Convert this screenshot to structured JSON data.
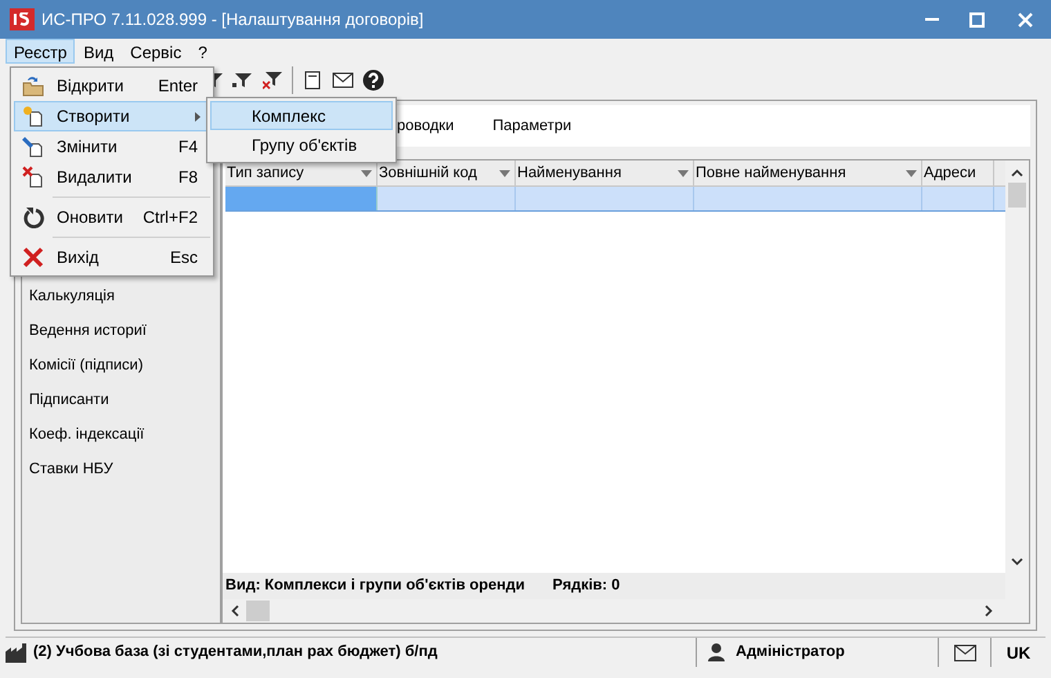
{
  "window": {
    "title": "ИС-ПРО 7.11.028.999 - [Налаштування договорів]"
  },
  "menubar": [
    {
      "label": "Реєстр",
      "selected": true
    },
    {
      "label": "Вид",
      "selected": false
    },
    {
      "label": "Сервіс",
      "selected": false
    },
    {
      "label": "?",
      "selected": false
    }
  ],
  "menu": {
    "groups": [
      [
        {
          "label": "Відкрити",
          "shortcut": "Enter",
          "submenu": false,
          "selected": false
        },
        {
          "label": "Створити",
          "submenu": true,
          "selected": true
        },
        {
          "label": "Змінити",
          "shortcut": "F4",
          "submenu": false,
          "selected": false
        },
        {
          "label": "Видалити",
          "shortcut": "F8",
          "submenu": false,
          "selected": false
        }
      ],
      [
        {
          "label": "Оновити",
          "shortcut": "Ctrl+F2",
          "submenu": false,
          "selected": false
        }
      ],
      [
        {
          "label": "Вихід",
          "shortcut": "Esc",
          "submenu": false,
          "selected": false
        }
      ]
    ]
  },
  "submenu": [
    {
      "label": "Комплекс",
      "selected": true
    },
    {
      "label": "Групу об'єктів",
      "selected": false
    }
  ],
  "tabs": [
    {
      "label": "роводки",
      "selected": false
    },
    {
      "label": "Параметри",
      "selected": false
    }
  ],
  "sidebar": {
    "items": [
      "Калькуляція",
      "Ведення историї",
      "Комісії (підписи)",
      "Підписанти",
      "Коеф. індексації",
      "Ставки НБУ"
    ]
  },
  "table": {
    "columns": [
      "Тип запису",
      "Зовнішній код",
      "Найменування",
      "Повне найменування",
      "Адреси"
    ],
    "rows": [
      {
        "selected": true
      }
    ],
    "footer_view": "Вид: Комплекси і групи об'єктів оренди",
    "footer_count": "Рядків: 0"
  },
  "status_bar": {
    "database": "(2) Учбова база (зі студентами,план рах бюджет) б/пд",
    "user": "Адміністратор",
    "language": "UK"
  }
}
